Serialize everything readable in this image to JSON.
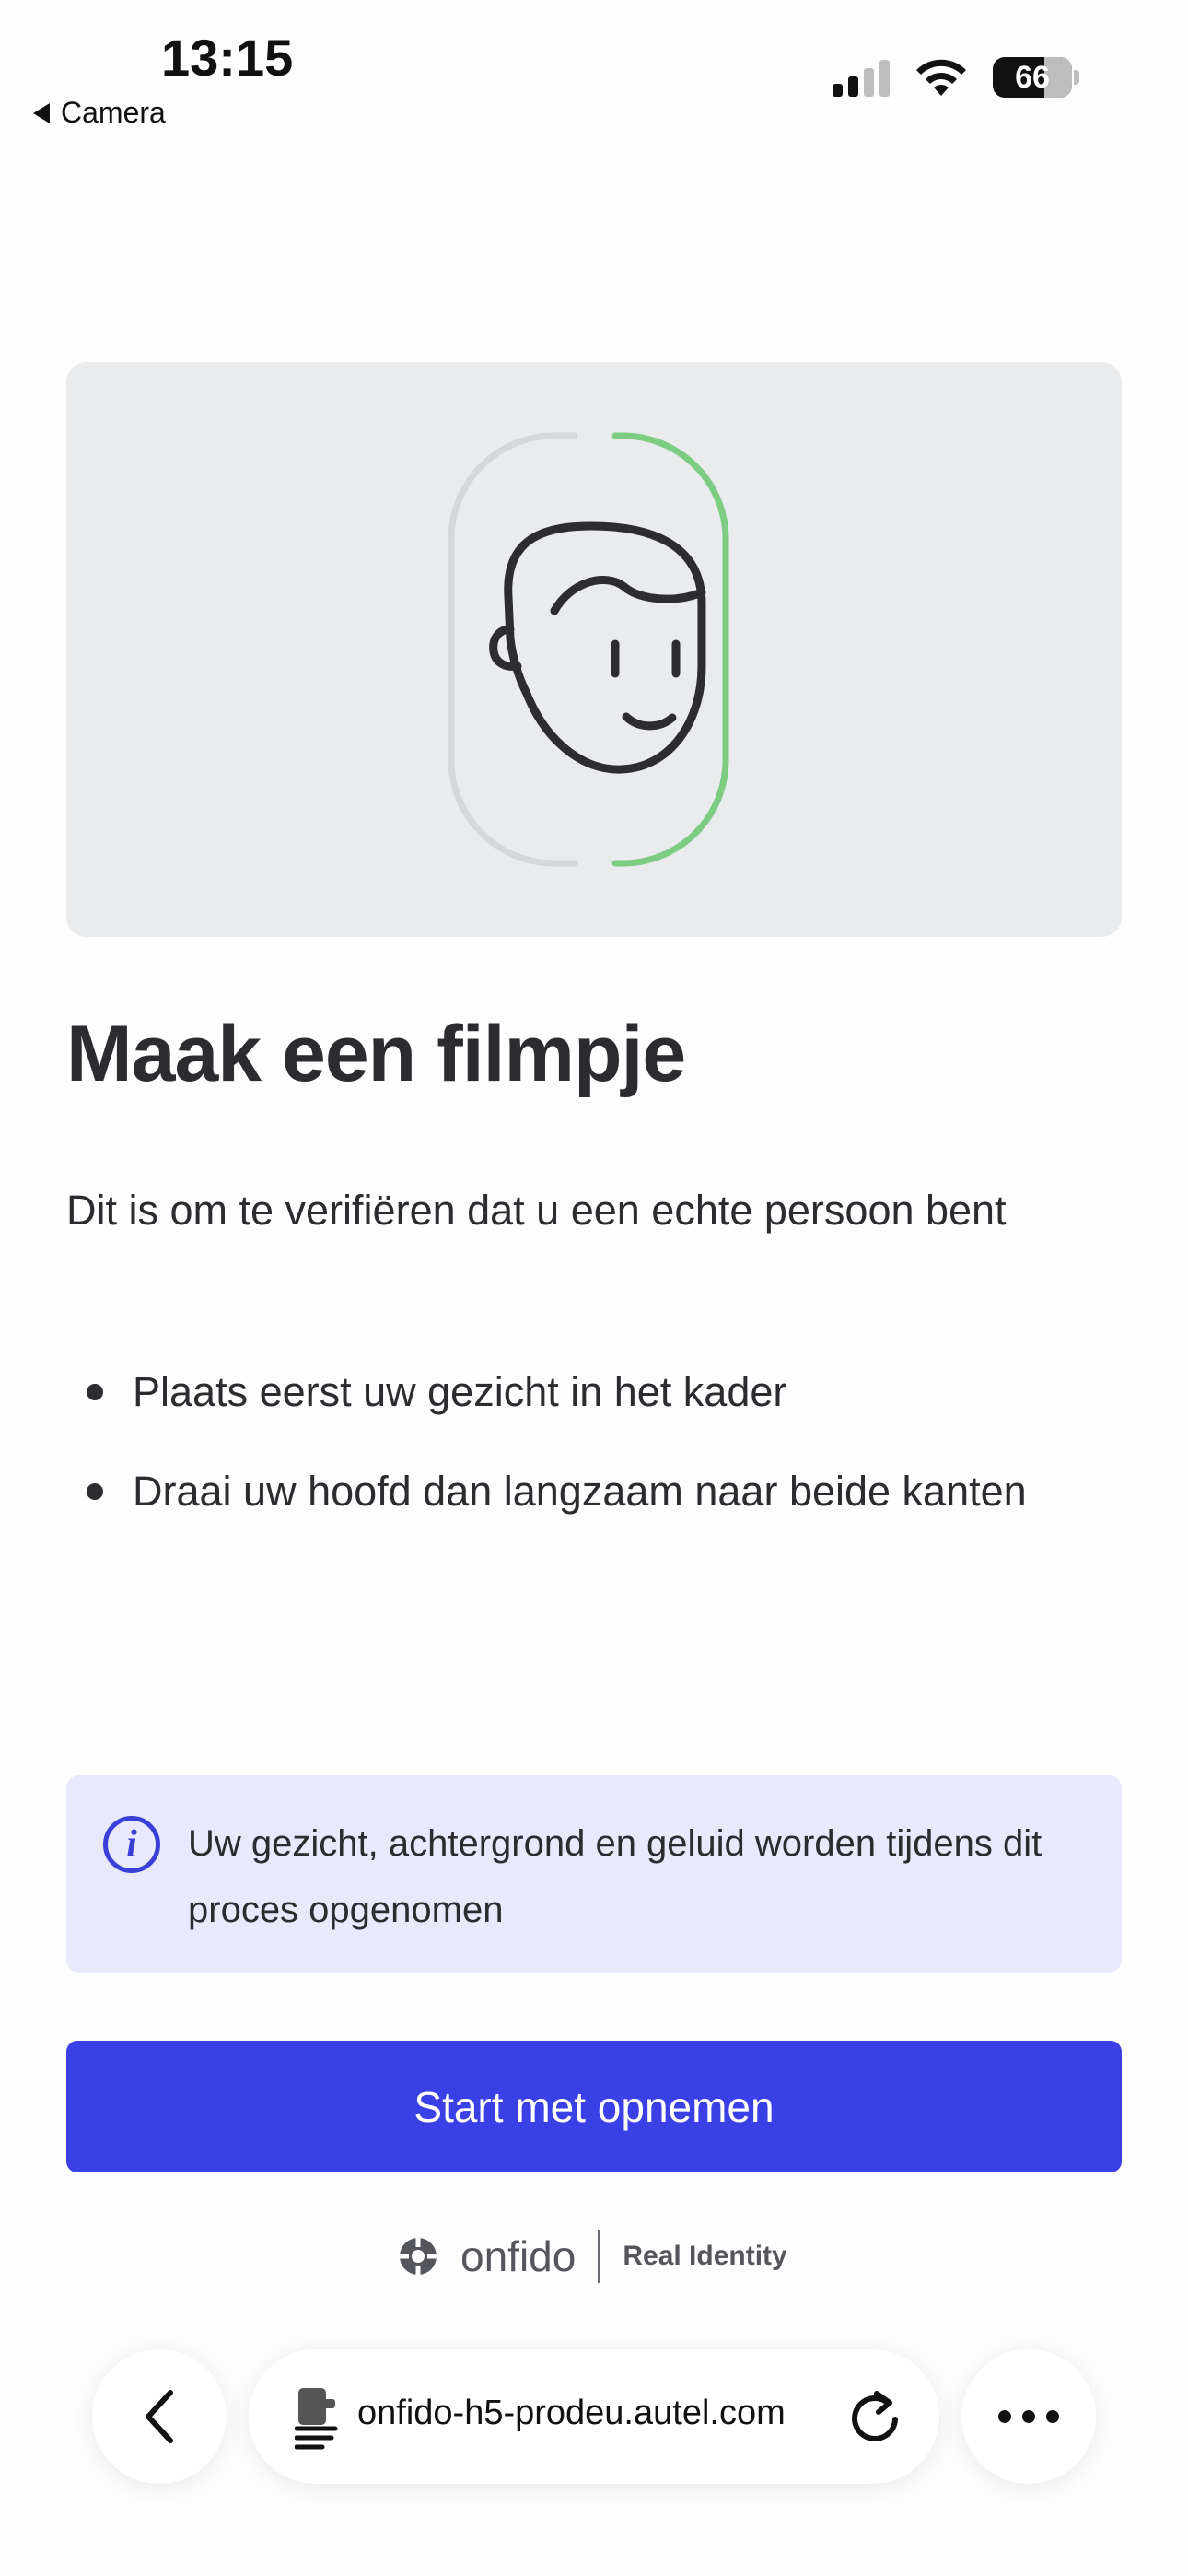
{
  "status_bar": {
    "time": "13:15",
    "back_app": "Camera",
    "battery": "66",
    "icons": [
      "cellular-signal-icon",
      "wifi-icon",
      "battery-icon"
    ]
  },
  "hero": {
    "illustration": "face-outline-with-turn-progress",
    "progress_color": "#7ccd82",
    "track_color": "#d8d9db"
  },
  "content": {
    "title": "Maak een filmpje",
    "subtitle": "Dit is om te verifiëren dat u een echte persoon bent",
    "bullets": [
      "Plaats eerst uw gezicht in het kader",
      "Draai uw hoofd dan langzaam naar beide kanten"
    ]
  },
  "notice": {
    "icon": "info-icon",
    "text": "Uw gezicht, achtergrond en geluid worden tijdens dit proces opgenomen"
  },
  "actions": {
    "start_label": "Start met opnemen",
    "button_color": "#3a3fe6"
  },
  "brand": {
    "name": "onfido",
    "tagline": "Real Identity"
  },
  "browser": {
    "url": "onfido-h5-prodeu.autel.com",
    "icons": [
      "back-chevron-icon",
      "page-menu-icon",
      "reload-icon",
      "more-icon"
    ]
  }
}
